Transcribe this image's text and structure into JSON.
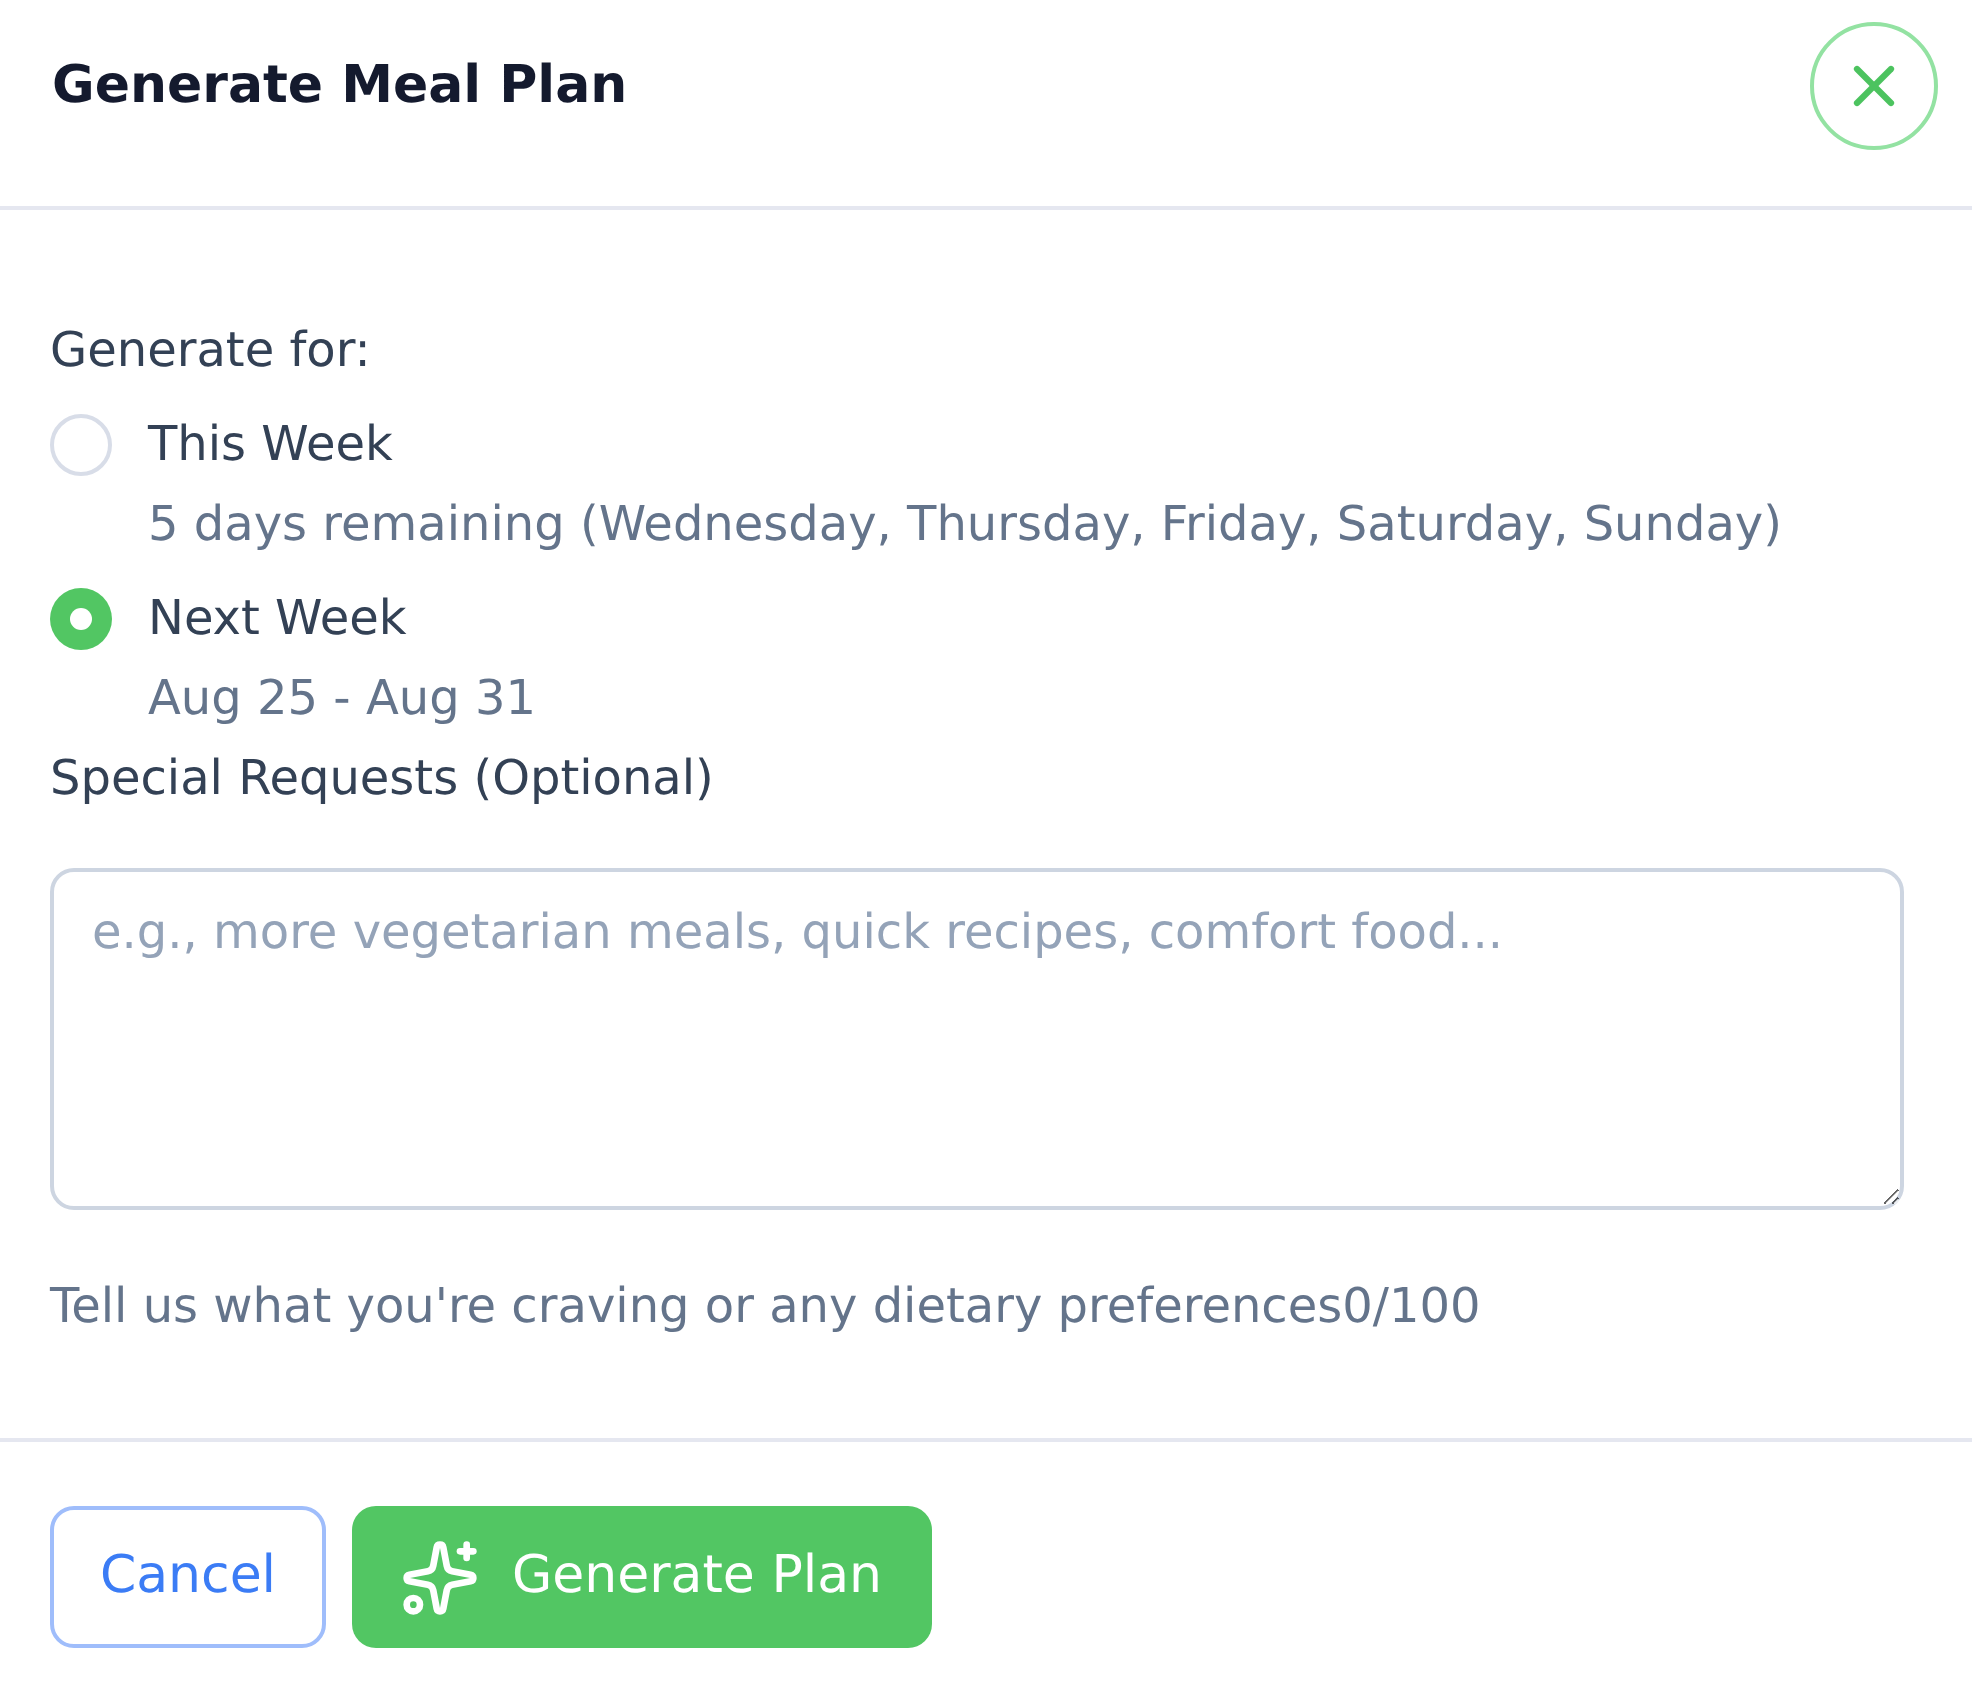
{
  "dialog": {
    "title": "Generate Meal Plan"
  },
  "generate_for": {
    "label": "Generate for:",
    "options": [
      {
        "label": "This Week",
        "description": "5 days remaining (Wednesday, Thursday, Friday, Saturday, Sunday)",
        "selected": false
      },
      {
        "label": "Next Week",
        "description": "Aug 25 - Aug 31",
        "selected": true
      }
    ]
  },
  "special_requests": {
    "label": "Special Requests (Optional)",
    "placeholder": "e.g., more vegetarian meals, quick recipes, comfort food...",
    "helper": "Tell us what you're craving or any dietary preferences",
    "counter": "0/100"
  },
  "buttons": [
    {
      "label": "Cancel",
      "kind": "secondary"
    },
    {
      "label": "Generate Plan",
      "kind": "primary"
    }
  ]
}
